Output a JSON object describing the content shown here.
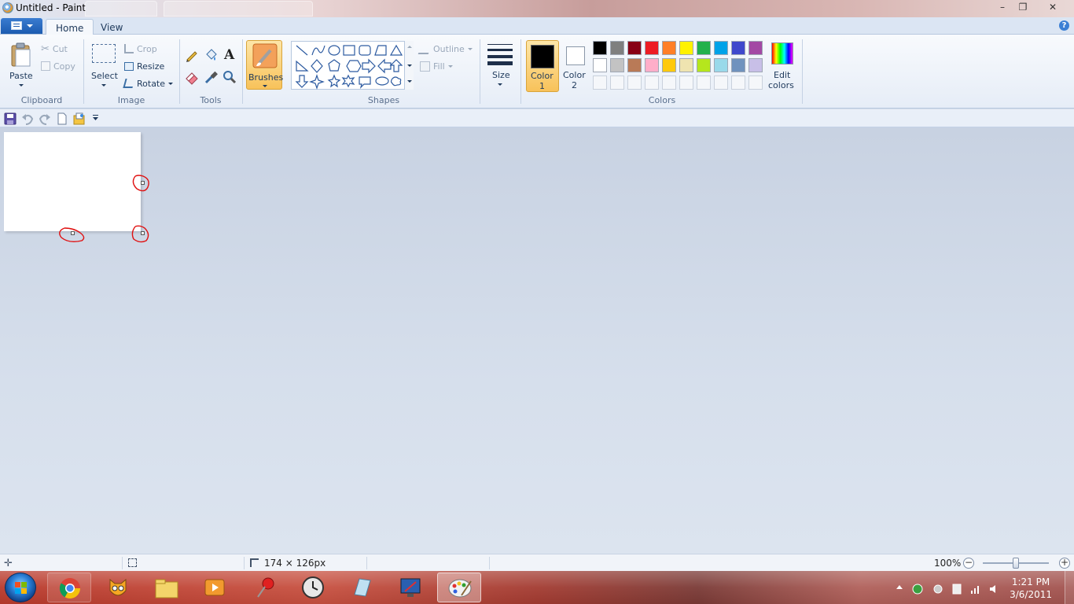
{
  "window": {
    "title": "Untitled - Paint",
    "background_tabs": [
      "",
      ""
    ],
    "controls": {
      "minimize": "–",
      "maximize": "❐",
      "close": "✕"
    }
  },
  "ribbon_tabs": [
    {
      "label": "Home",
      "active": true
    },
    {
      "label": "View",
      "active": false
    }
  ],
  "help": "?",
  "clipboard": {
    "paste": "Paste",
    "cut": "Cut",
    "copy": "Copy",
    "group": "Clipboard"
  },
  "image": {
    "select": "Select",
    "crop": "Crop",
    "resize": "Resize",
    "rotate": "Rotate",
    "group": "Image"
  },
  "tools": {
    "group": "Tools",
    "text_glyph": "A"
  },
  "brushes": {
    "label": "Brushes"
  },
  "shapes": {
    "outline": "Outline",
    "fill": "Fill",
    "group": "Shapes"
  },
  "size": {
    "label": "Size"
  },
  "colors": {
    "color1": {
      "line1": "Color",
      "line2": "1",
      "value": "#000000"
    },
    "color2": {
      "line1": "Color",
      "line2": "2",
      "value": "#ffffff"
    },
    "palette_row1": [
      "#000000",
      "#7f7f7f",
      "#880015",
      "#ed1c24",
      "#ff7f27",
      "#fff200",
      "#22b14c",
      "#00a2e8",
      "#3f48cc",
      "#a349a4"
    ],
    "palette_row2": [
      "#ffffff",
      "#c3c3c3",
      "#b97a57",
      "#ffaec9",
      "#ffc90e",
      "#efe4b0",
      "#b5e61d",
      "#99d9ea",
      "#7092be",
      "#c8bfe7"
    ],
    "edit_line1": "Edit",
    "edit_line2": "colors",
    "group": "Colors"
  },
  "status": {
    "canvas_size": "174 × 126px",
    "zoom": "100%",
    "zoom_out": "−",
    "zoom_in": "+"
  },
  "clock": {
    "time": "1:21 PM",
    "date": "3/6/2011"
  }
}
